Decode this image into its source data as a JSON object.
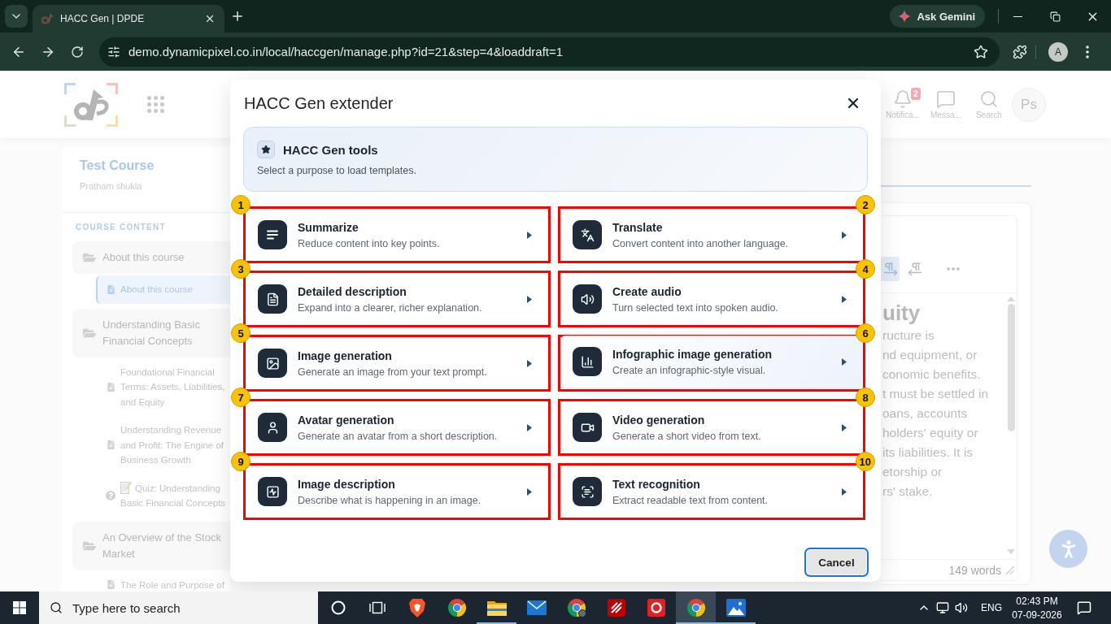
{
  "browser": {
    "tab_title": "HACC Gen | DPDE",
    "gemini_label": "Ask Gemini",
    "url": "demo.dynamicpixel.co.in/local/haccgen/manage.php?id=21&step=4&loaddraft=1",
    "profile_initial": "A"
  },
  "site_header": {
    "actions": [
      {
        "kind": "bell",
        "label": "Notifica...",
        "badge": "2"
      },
      {
        "kind": "chat",
        "label": "Messa..."
      },
      {
        "kind": "search",
        "label": "Search"
      }
    ],
    "avatar": "Ps"
  },
  "sidebar": {
    "course_title": "Test Course",
    "author": "Pratham shukla",
    "heading": "COURSE CONTENT",
    "sections": [
      {
        "label": "About this course",
        "expanded": true,
        "children": [
          {
            "kind": "page",
            "label": "About this course",
            "selected": true
          }
        ]
      },
      {
        "label": "Understanding Basic Financial Concepts",
        "expanded": true,
        "children": [
          {
            "kind": "page",
            "label": "Foundational Financial Terms: Assets, Liabilities, and Equity",
            "selected": false
          },
          {
            "kind": "page",
            "label": "Understanding Revenue and Profit: The Engine of Business Growth",
            "selected": false
          },
          {
            "kind": "quiz",
            "label": "Quiz: Understanding Basic Financial Concepts",
            "selected": false
          }
        ]
      },
      {
        "label": "An Overview of the Stock Market",
        "expanded": true,
        "children": [
          {
            "kind": "page",
            "label": "The Role and Purpose of",
            "selected": false
          }
        ]
      }
    ]
  },
  "editor": {
    "toolbar": [
      {
        "kind": "ltr",
        "selected": true
      },
      {
        "kind": "rtl",
        "selected": false
      },
      {
        "kind": "more",
        "selected": false
      }
    ],
    "heading": "uity",
    "lines": [
      "ructure is",
      "nd equipment, or",
      "conomic benefits.",
      "t must be settled in",
      "oans, accounts",
      "holders' equity or",
      "its liabilities. It is",
      "etorship or",
      "rs' stake."
    ],
    "word_count": "149 words"
  },
  "modal": {
    "title": "HACC Gen extender",
    "intro": {
      "title": "HACC Gen tools",
      "subtitle": "Select a purpose to load templates."
    },
    "tools": [
      {
        "number": "1",
        "title": "Summarize",
        "description": "Reduce content into key points.",
        "hovered": false
      },
      {
        "number": "2",
        "title": "Translate",
        "description": "Convert content into another language.",
        "hovered": false
      },
      {
        "number": "3",
        "title": "Detailed description",
        "description": "Expand into a clearer, richer explanation.",
        "hovered": false
      },
      {
        "number": "4",
        "title": "Create audio",
        "description": "Turn selected text into spoken audio.",
        "hovered": false
      },
      {
        "number": "5",
        "title": "Image generation",
        "description": "Generate an image from your text prompt.",
        "hovered": false
      },
      {
        "number": "6",
        "title": "Infographic image generation",
        "description": "Create an infographic-style visual.",
        "hovered": true
      },
      {
        "number": "7",
        "title": "Avatar generation",
        "description": "Generate an avatar from a short description.",
        "hovered": false
      },
      {
        "number": "8",
        "title": "Video generation",
        "description": "Generate a short video from text.",
        "hovered": false
      },
      {
        "number": "9",
        "title": "Image description",
        "description": "Describe what is happening in an image.",
        "hovered": false
      },
      {
        "number": "10",
        "title": "Text recognition",
        "description": "Extract readable text from content.",
        "hovered": false
      }
    ],
    "cancel": {
      "label": "Cancel",
      "focused": true
    }
  },
  "taskbar": {
    "search_placeholder": "Type here to search",
    "apps": [
      {
        "kind": "shield",
        "running": false,
        "active": false
      },
      {
        "kind": "browser",
        "running": false,
        "active": false
      },
      {
        "kind": "folder",
        "running": true,
        "active": false
      },
      {
        "kind": "mail",
        "running": false,
        "active": false
      },
      {
        "kind": "browser_profile",
        "running": false,
        "active": false
      },
      {
        "kind": "ftp",
        "running": false,
        "active": false
      },
      {
        "kind": "office",
        "running": false,
        "active": false
      },
      {
        "kind": "browser",
        "running": true,
        "active": true
      },
      {
        "kind": "photos",
        "running": true,
        "active": false
      }
    ],
    "language": "ENG",
    "time": "02:43 PM",
    "date": "07-09-2026"
  }
}
